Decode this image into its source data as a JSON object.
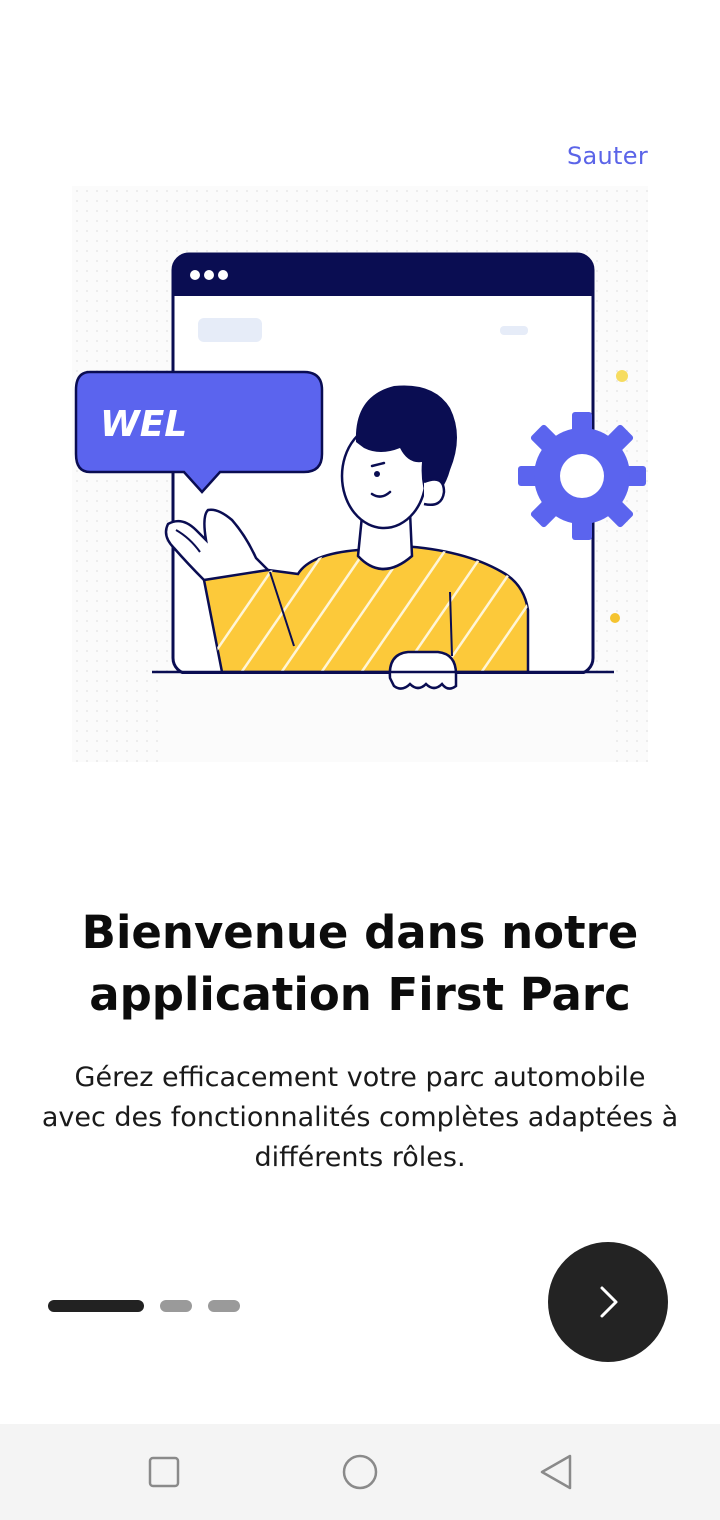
{
  "header": {
    "skip_label": "Sauter"
  },
  "illustration": {
    "bubble_text": "WEL",
    "icons": [
      "browser-window",
      "speech-bubble",
      "person",
      "gear-icon"
    ]
  },
  "content": {
    "title": "Bienvenue dans notre application First Parc",
    "description": "Gérez efficacement votre parc automobile avec des fonctionnalités complètes adaptées à différents rôles."
  },
  "pagination": {
    "current_page": 1,
    "total_pages": 3
  },
  "next_button": {
    "icon": "chevron-right-icon"
  },
  "system_nav": {
    "icons": [
      "square-icon",
      "circle-icon",
      "triangle-back-icon"
    ]
  },
  "colors": {
    "accent": "#5b64e8",
    "navy": "#0a0d52",
    "yellow": "#fcc93a",
    "dark_button": "#232323"
  }
}
